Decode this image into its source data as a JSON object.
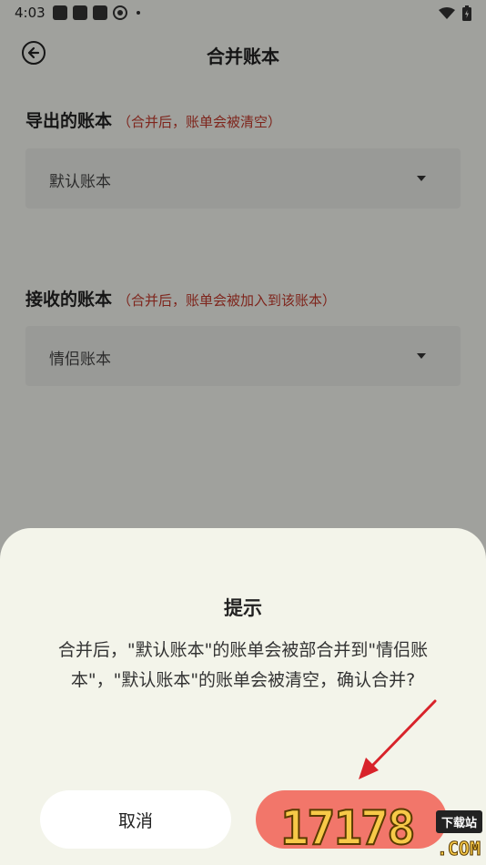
{
  "status_bar": {
    "time": "4:03"
  },
  "header": {
    "title": "合并账本"
  },
  "export_section": {
    "label": "导出的账本",
    "note": "（合并后，账单会被清空）",
    "selected": "默认账本"
  },
  "receive_section": {
    "label": "接收的账本",
    "note": "（合并后，账单会被加入到该账本）",
    "selected": "情侣账本"
  },
  "dialog": {
    "title": "提示",
    "message": "合并后，\"默认账本\"的账单会被部合并到\"情侣账本\"，\"默认账本\"的账单会被清空，确认合并?",
    "cancel_label": "取消",
    "confirm_label": ""
  },
  "watermark": {
    "number": "17178",
    "badge": "下载站",
    "suffix": ".COM"
  },
  "colors": {
    "accent": "#f2766a",
    "note_red": "#c0392b",
    "sheet_bg": "#f3f4ea"
  },
  "icons": {
    "back": "back-circle-icon",
    "dropdown": "caret-down-icon",
    "wifi": "wifi-icon",
    "battery": "battery-icon"
  }
}
